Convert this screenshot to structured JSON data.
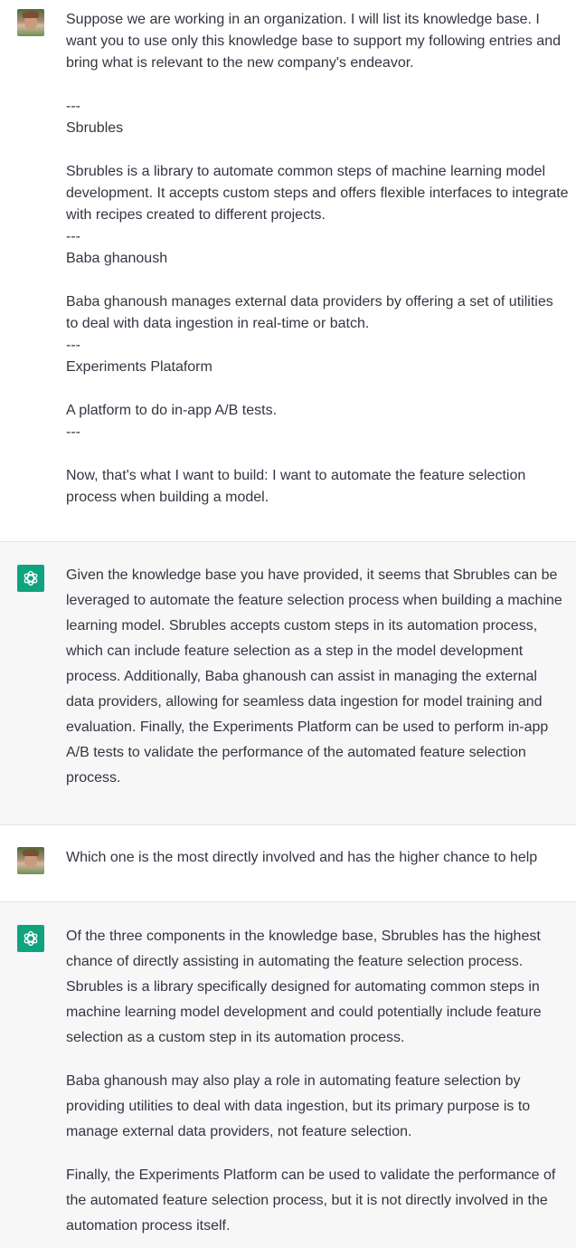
{
  "conversation": {
    "turns": [
      {
        "role": "user",
        "lines": [
          "Suppose we are working in an organization. I will list its knowledge base. I want you to use only this knowledge base to support my following entries and bring what is relevant to the new company's endeavor.",
          "",
          "---",
          "Sbrubles",
          "",
          "Sbrubles is a library to automate common steps of machine learning model development. It accepts custom steps and offers flexible interfaces to integrate with recipes created to different projects.",
          "---",
          "Baba ghanoush",
          "",
          "Baba ghanoush manages external data providers by offering a set of utilities to deal with data ingestion in real-time or batch.",
          "---",
          "Experiments Plataform",
          "",
          "A platform to do in-app A/B tests.",
          "---",
          "",
          "Now, that's what I want to build: I want to automate the feature selection process when building a model."
        ]
      },
      {
        "role": "assistant",
        "paragraphs": [
          "Given the knowledge base you have provided, it seems that Sbrubles can be leveraged to automate the feature selection process when building a machine learning model. Sbrubles accepts custom steps in its automation process, which can include feature selection as a step in the model development process. Additionally, Baba ghanoush can assist in managing the external data providers, allowing for seamless data ingestion for model training and evaluation. Finally, the Experiments Platform can be used to perform in-app A/B tests to validate the performance of the automated feature selection process."
        ]
      },
      {
        "role": "user",
        "lines": [
          "Which one is the most directly involved and has the higher chance to help"
        ]
      },
      {
        "role": "assistant",
        "paragraphs": [
          "Of the three components in the knowledge base, Sbrubles has the highest chance of directly assisting in automating the feature selection process. Sbrubles is a library specifically designed for automating common steps in machine learning model development and could potentially include feature selection as a custom step in its automation process.",
          "Baba ghanoush may also play a role in automating feature selection by providing utilities to deal with data ingestion, but its primary purpose is to manage external data providers, not feature selection.",
          "Finally, the Experiments Platform can be used to validate the performance of the automated feature selection process, but it is not directly involved in the automation process itself."
        ]
      }
    ]
  },
  "icons": {
    "user_avatar": "user-photo-avatar",
    "assistant_avatar": "openai-logo-icon"
  },
  "colors": {
    "user_bg": "#ffffff",
    "assistant_bg": "#f7f7f8",
    "assistant_avatar_bg": "#10a37f",
    "text": "#343541",
    "divider": "#e3e3e6"
  }
}
